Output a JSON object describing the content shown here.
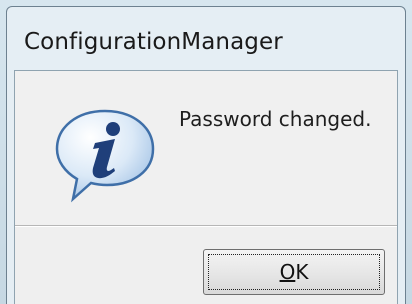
{
  "window": {
    "title": "ConfigurationManager"
  },
  "dialog": {
    "icon": "information-icon",
    "message": "Password changed."
  },
  "buttons": {
    "ok_mnemonic": "O",
    "ok_rest": "K"
  },
  "colors": {
    "frame": "#d7e6ef",
    "client": "#f0f0f0",
    "icon_blue": "#1f4f8f",
    "icon_fill": "#dbe9f7"
  }
}
